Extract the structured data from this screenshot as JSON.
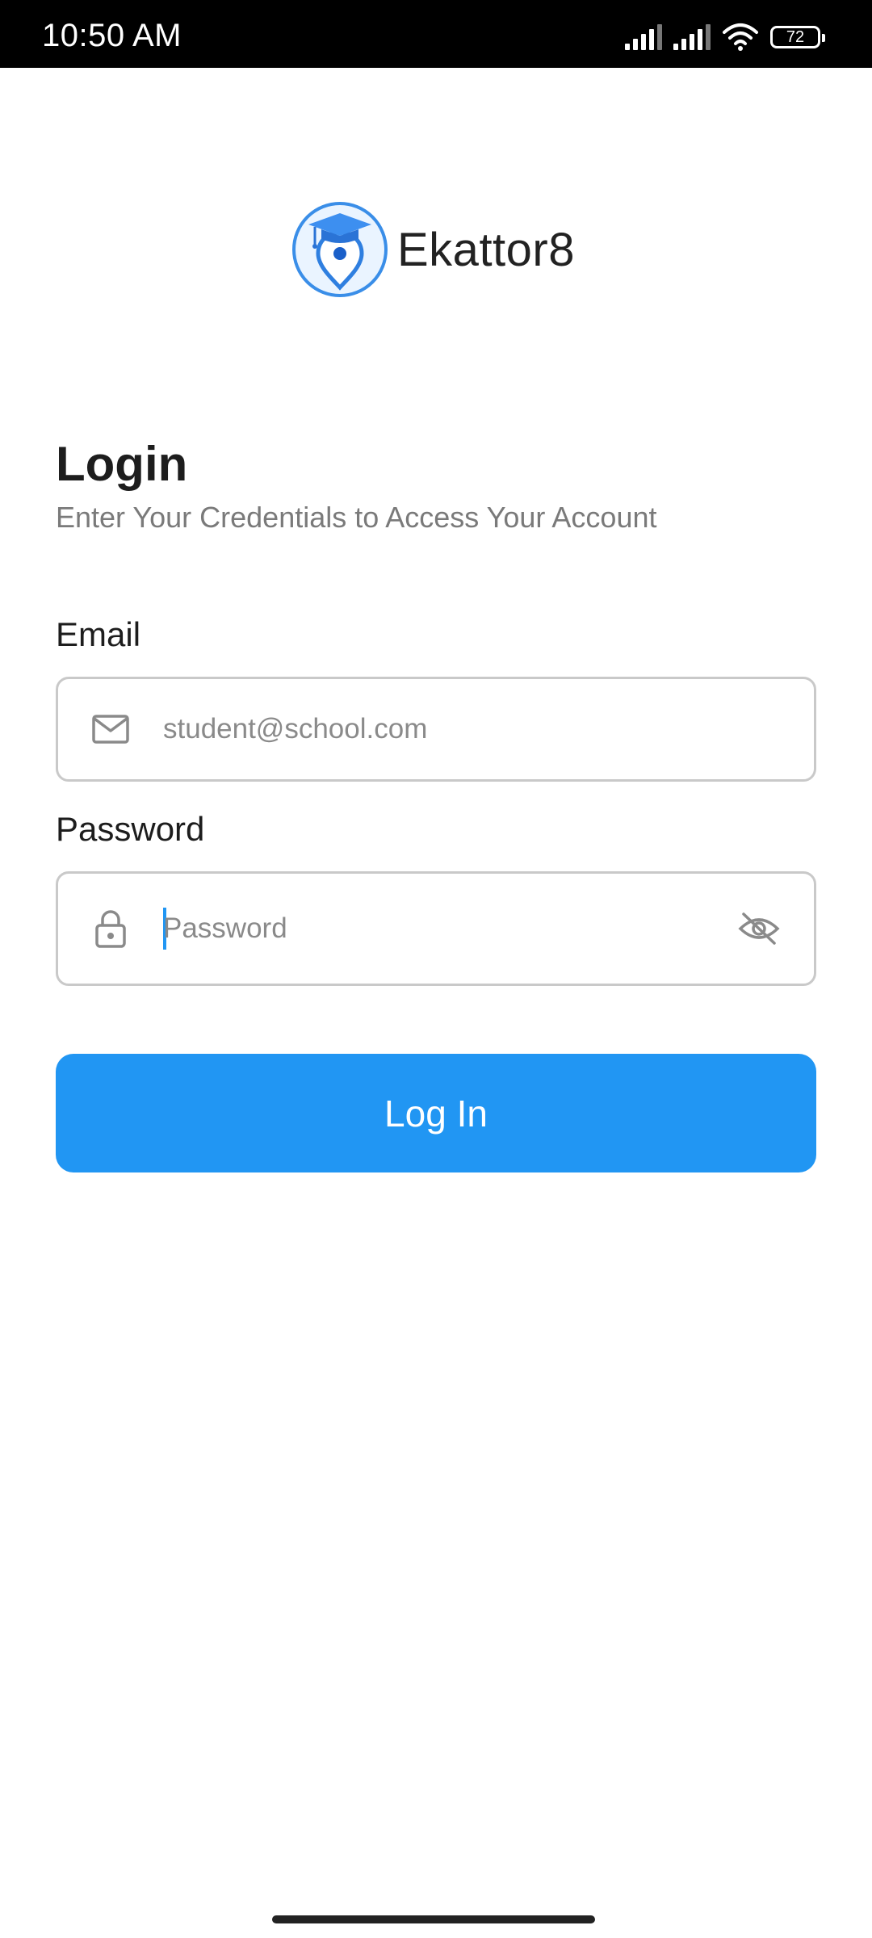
{
  "status_bar": {
    "time": "10:50 AM",
    "battery": "72",
    "icons": [
      "signal-icon",
      "signal-icon",
      "wifi-icon",
      "battery-icon"
    ]
  },
  "brand": {
    "name": "Ekattor8",
    "logo_icon": "graduation-cap-location-pin-icon"
  },
  "login": {
    "title": "Login",
    "subtitle": "Enter Your Credentials to Access Your Account"
  },
  "email": {
    "label": "Email",
    "value": "student@school.com",
    "icon": "mail-icon"
  },
  "password": {
    "label": "Password",
    "placeholder": "Password",
    "icon": "lock-icon",
    "toggle_icon": "eye-off-icon"
  },
  "button": {
    "label": "Log In",
    "color": "#2196f3"
  }
}
